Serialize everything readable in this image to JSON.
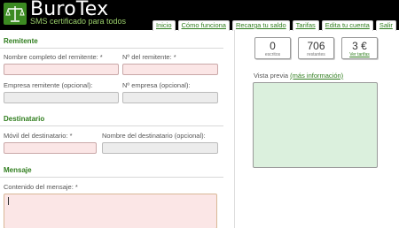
{
  "brand": {
    "name": "BuroTex",
    "tagline": "SMS certificado para todos"
  },
  "nav": [
    {
      "label": "Inicio"
    },
    {
      "label": "Cómo funciona"
    },
    {
      "label": "Recarga tu saldo"
    },
    {
      "label": "Tarifas"
    },
    {
      "label": "Edita tu cuenta"
    },
    {
      "label": "Salir"
    }
  ],
  "remitente": {
    "title": "Remitente",
    "nombre_label": "Nombre completo del remitente: *",
    "nif_label": "Nº del remitente: *",
    "empresa_label": "Empresa remitente (opcional):",
    "nif_empresa_label": "Nº empresa (opcional):"
  },
  "destinatario": {
    "title": "Destinatario",
    "movil_label": "Móvil del destinatario: *",
    "nombre_label": "Nombre del destinatario (opcional):"
  },
  "mensaje": {
    "title": "Mensaje",
    "contenido_label": "Contenido del mensaje: *"
  },
  "counters": {
    "escritos_value": "0",
    "escritos_label": "escritos",
    "restantes_value": "706",
    "restantes_label": "restantes",
    "precio_value": "3 €",
    "precio_label": "Ver tarifas"
  },
  "preview": {
    "label": "Vista previa",
    "link": "(más información)"
  },
  "colors": {
    "accent": "#2f7d1d",
    "required_field": "#fbe6e6",
    "optional_field": "#ececec",
    "preview_bg": "#dbf0dd",
    "header_bg": "#000000"
  }
}
